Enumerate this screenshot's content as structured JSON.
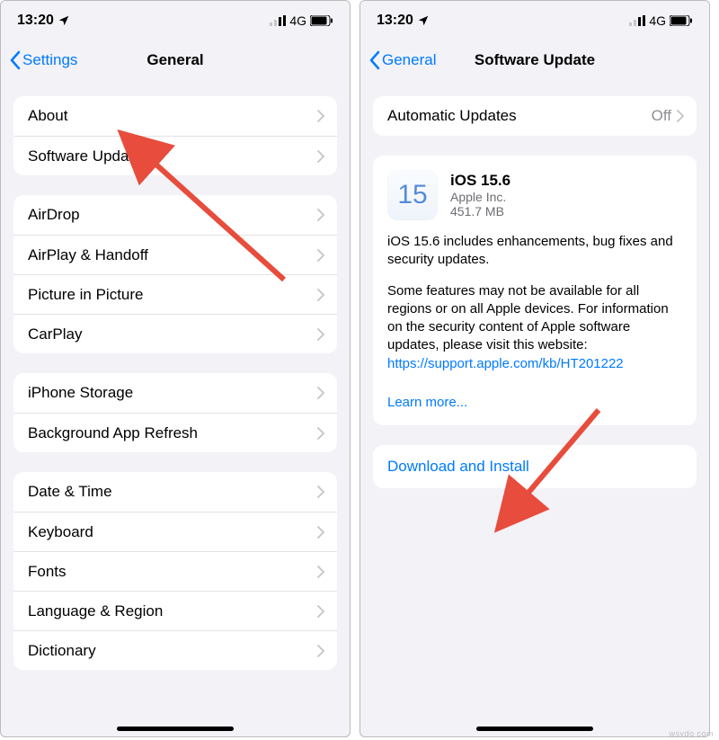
{
  "status": {
    "time": "13:20",
    "network": "4G"
  },
  "left": {
    "back": "Settings",
    "title": "General",
    "groups": [
      [
        {
          "label": "About"
        },
        {
          "label": "Software Update"
        }
      ],
      [
        {
          "label": "AirDrop"
        },
        {
          "label": "AirPlay & Handoff"
        },
        {
          "label": "Picture in Picture"
        },
        {
          "label": "CarPlay"
        }
      ],
      [
        {
          "label": "iPhone Storage"
        },
        {
          "label": "Background App Refresh"
        }
      ],
      [
        {
          "label": "Date & Time"
        },
        {
          "label": "Keyboard"
        },
        {
          "label": "Fonts"
        },
        {
          "label": "Language & Region"
        },
        {
          "label": "Dictionary"
        }
      ]
    ]
  },
  "right": {
    "back": "General",
    "title": "Software Update",
    "auto_row": {
      "label": "Automatic Updates",
      "value": "Off"
    },
    "update": {
      "icon_text": "15",
      "name": "iOS 15.6",
      "vendor": "Apple Inc.",
      "size": "451.7 MB",
      "para1": "iOS 15.6 includes enhancements, bug fixes and security updates.",
      "para2": "Some features may not be available for all regions or on all Apple devices. For information on the security content of Apple software updates, please visit this website:",
      "link": "https://support.apple.com/kb/HT201222",
      "learn": "Learn more..."
    },
    "action": "Download and Install"
  },
  "watermark": "wsvdo com"
}
